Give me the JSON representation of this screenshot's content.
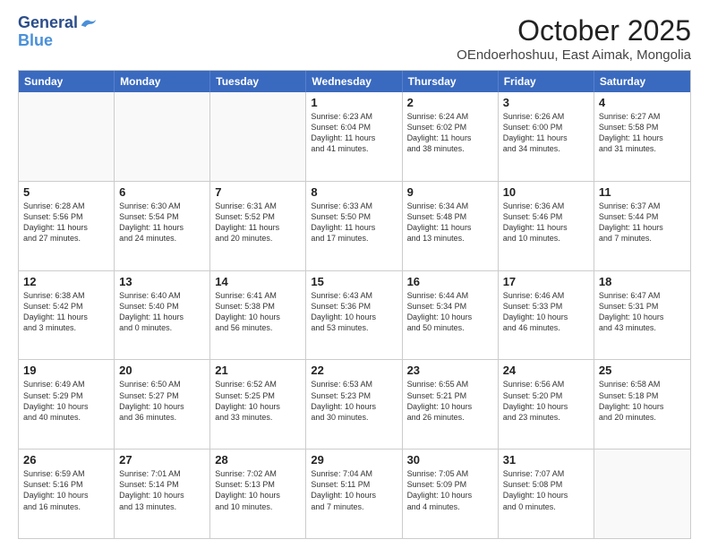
{
  "header": {
    "logo_line1": "General",
    "logo_line2": "Blue",
    "month": "October 2025",
    "location": "OEndoerhoshuu, East Aimak, Mongolia"
  },
  "weekdays": [
    "Sunday",
    "Monday",
    "Tuesday",
    "Wednesday",
    "Thursday",
    "Friday",
    "Saturday"
  ],
  "rows": [
    [
      {
        "day": "",
        "lines": []
      },
      {
        "day": "",
        "lines": []
      },
      {
        "day": "",
        "lines": []
      },
      {
        "day": "1",
        "lines": [
          "Sunrise: 6:23 AM",
          "Sunset: 6:04 PM",
          "Daylight: 11 hours",
          "and 41 minutes."
        ]
      },
      {
        "day": "2",
        "lines": [
          "Sunrise: 6:24 AM",
          "Sunset: 6:02 PM",
          "Daylight: 11 hours",
          "and 38 minutes."
        ]
      },
      {
        "day": "3",
        "lines": [
          "Sunrise: 6:26 AM",
          "Sunset: 6:00 PM",
          "Daylight: 11 hours",
          "and 34 minutes."
        ]
      },
      {
        "day": "4",
        "lines": [
          "Sunrise: 6:27 AM",
          "Sunset: 5:58 PM",
          "Daylight: 11 hours",
          "and 31 minutes."
        ]
      }
    ],
    [
      {
        "day": "5",
        "lines": [
          "Sunrise: 6:28 AM",
          "Sunset: 5:56 PM",
          "Daylight: 11 hours",
          "and 27 minutes."
        ]
      },
      {
        "day": "6",
        "lines": [
          "Sunrise: 6:30 AM",
          "Sunset: 5:54 PM",
          "Daylight: 11 hours",
          "and 24 minutes."
        ]
      },
      {
        "day": "7",
        "lines": [
          "Sunrise: 6:31 AM",
          "Sunset: 5:52 PM",
          "Daylight: 11 hours",
          "and 20 minutes."
        ]
      },
      {
        "day": "8",
        "lines": [
          "Sunrise: 6:33 AM",
          "Sunset: 5:50 PM",
          "Daylight: 11 hours",
          "and 17 minutes."
        ]
      },
      {
        "day": "9",
        "lines": [
          "Sunrise: 6:34 AM",
          "Sunset: 5:48 PM",
          "Daylight: 11 hours",
          "and 13 minutes."
        ]
      },
      {
        "day": "10",
        "lines": [
          "Sunrise: 6:36 AM",
          "Sunset: 5:46 PM",
          "Daylight: 11 hours",
          "and 10 minutes."
        ]
      },
      {
        "day": "11",
        "lines": [
          "Sunrise: 6:37 AM",
          "Sunset: 5:44 PM",
          "Daylight: 11 hours",
          "and 7 minutes."
        ]
      }
    ],
    [
      {
        "day": "12",
        "lines": [
          "Sunrise: 6:38 AM",
          "Sunset: 5:42 PM",
          "Daylight: 11 hours",
          "and 3 minutes."
        ]
      },
      {
        "day": "13",
        "lines": [
          "Sunrise: 6:40 AM",
          "Sunset: 5:40 PM",
          "Daylight: 11 hours",
          "and 0 minutes."
        ]
      },
      {
        "day": "14",
        "lines": [
          "Sunrise: 6:41 AM",
          "Sunset: 5:38 PM",
          "Daylight: 10 hours",
          "and 56 minutes."
        ]
      },
      {
        "day": "15",
        "lines": [
          "Sunrise: 6:43 AM",
          "Sunset: 5:36 PM",
          "Daylight: 10 hours",
          "and 53 minutes."
        ]
      },
      {
        "day": "16",
        "lines": [
          "Sunrise: 6:44 AM",
          "Sunset: 5:34 PM",
          "Daylight: 10 hours",
          "and 50 minutes."
        ]
      },
      {
        "day": "17",
        "lines": [
          "Sunrise: 6:46 AM",
          "Sunset: 5:33 PM",
          "Daylight: 10 hours",
          "and 46 minutes."
        ]
      },
      {
        "day": "18",
        "lines": [
          "Sunrise: 6:47 AM",
          "Sunset: 5:31 PM",
          "Daylight: 10 hours",
          "and 43 minutes."
        ]
      }
    ],
    [
      {
        "day": "19",
        "lines": [
          "Sunrise: 6:49 AM",
          "Sunset: 5:29 PM",
          "Daylight: 10 hours",
          "and 40 minutes."
        ]
      },
      {
        "day": "20",
        "lines": [
          "Sunrise: 6:50 AM",
          "Sunset: 5:27 PM",
          "Daylight: 10 hours",
          "and 36 minutes."
        ]
      },
      {
        "day": "21",
        "lines": [
          "Sunrise: 6:52 AM",
          "Sunset: 5:25 PM",
          "Daylight: 10 hours",
          "and 33 minutes."
        ]
      },
      {
        "day": "22",
        "lines": [
          "Sunrise: 6:53 AM",
          "Sunset: 5:23 PM",
          "Daylight: 10 hours",
          "and 30 minutes."
        ]
      },
      {
        "day": "23",
        "lines": [
          "Sunrise: 6:55 AM",
          "Sunset: 5:21 PM",
          "Daylight: 10 hours",
          "and 26 minutes."
        ]
      },
      {
        "day": "24",
        "lines": [
          "Sunrise: 6:56 AM",
          "Sunset: 5:20 PM",
          "Daylight: 10 hours",
          "and 23 minutes."
        ]
      },
      {
        "day": "25",
        "lines": [
          "Sunrise: 6:58 AM",
          "Sunset: 5:18 PM",
          "Daylight: 10 hours",
          "and 20 minutes."
        ]
      }
    ],
    [
      {
        "day": "26",
        "lines": [
          "Sunrise: 6:59 AM",
          "Sunset: 5:16 PM",
          "Daylight: 10 hours",
          "and 16 minutes."
        ]
      },
      {
        "day": "27",
        "lines": [
          "Sunrise: 7:01 AM",
          "Sunset: 5:14 PM",
          "Daylight: 10 hours",
          "and 13 minutes."
        ]
      },
      {
        "day": "28",
        "lines": [
          "Sunrise: 7:02 AM",
          "Sunset: 5:13 PM",
          "Daylight: 10 hours",
          "and 10 minutes."
        ]
      },
      {
        "day": "29",
        "lines": [
          "Sunrise: 7:04 AM",
          "Sunset: 5:11 PM",
          "Daylight: 10 hours",
          "and 7 minutes."
        ]
      },
      {
        "day": "30",
        "lines": [
          "Sunrise: 7:05 AM",
          "Sunset: 5:09 PM",
          "Daylight: 10 hours",
          "and 4 minutes."
        ]
      },
      {
        "day": "31",
        "lines": [
          "Sunrise: 7:07 AM",
          "Sunset: 5:08 PM",
          "Daylight: 10 hours",
          "and 0 minutes."
        ]
      },
      {
        "day": "",
        "lines": []
      }
    ]
  ]
}
